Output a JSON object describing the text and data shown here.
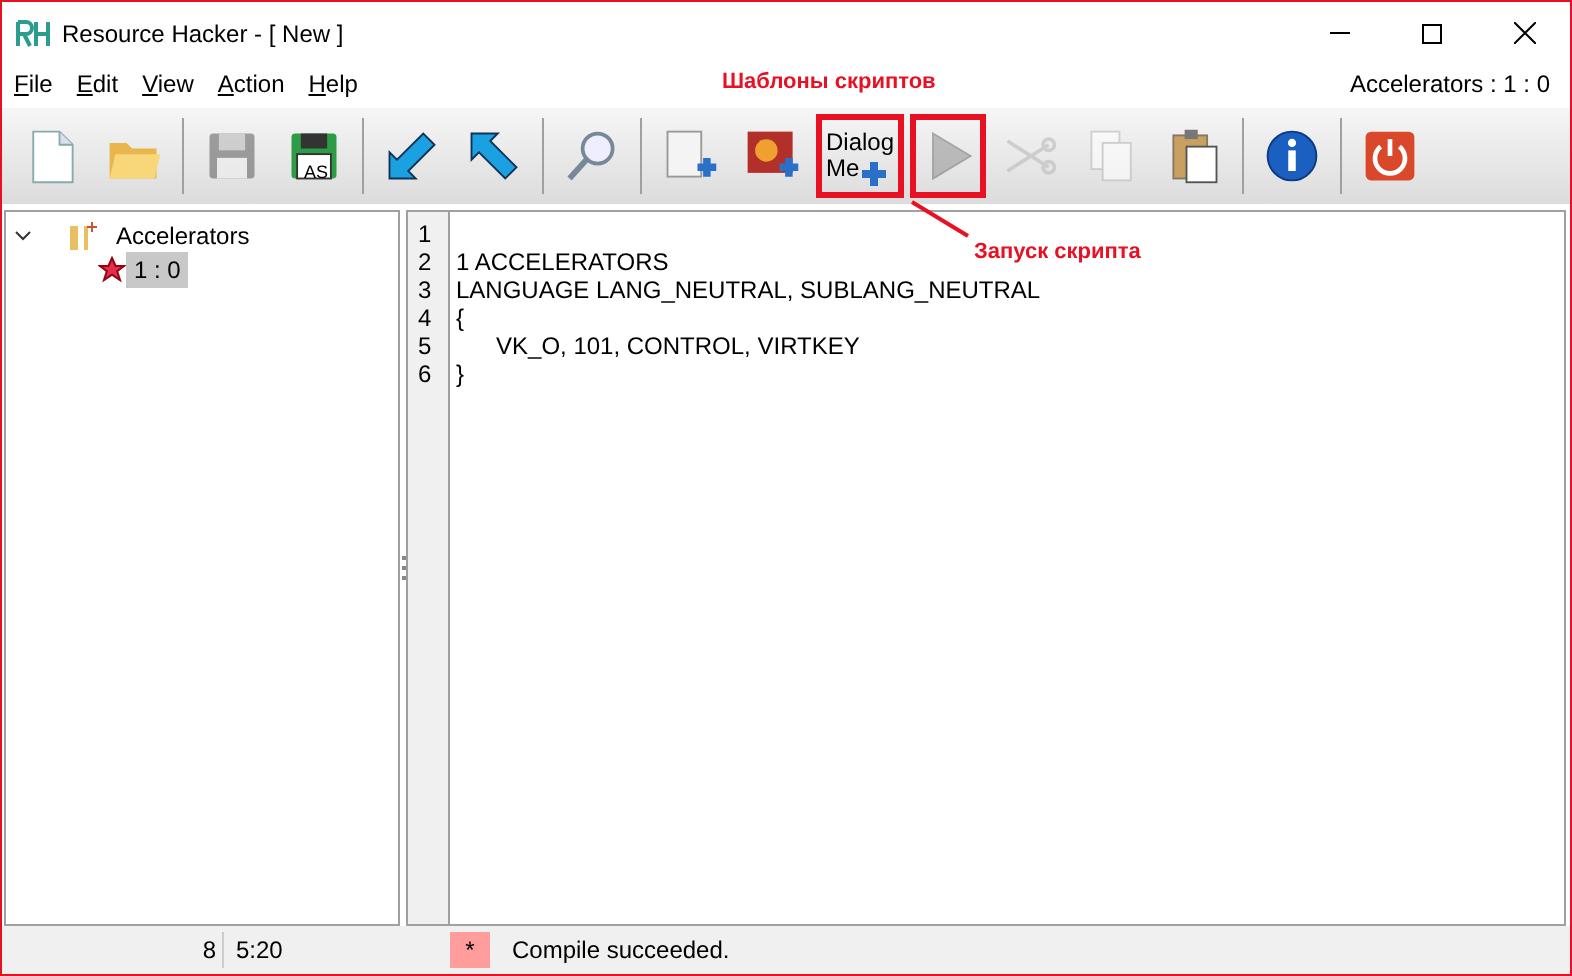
{
  "window": {
    "title": "Resource Hacker - [ New ]"
  },
  "menu": [
    {
      "label": "File"
    },
    {
      "label": "Edit"
    },
    {
      "label": "View"
    },
    {
      "label": "Action"
    },
    {
      "label": "Help"
    }
  ],
  "resource_label": "Accelerators : 1 : 0",
  "toolbar": [
    {
      "kind": "new",
      "disabled": false,
      "highlighted": false
    },
    {
      "kind": "open",
      "disabled": false,
      "highlighted": false
    },
    {
      "kind": "separator"
    },
    {
      "kind": "save",
      "disabled": true,
      "highlighted": false
    },
    {
      "kind": "save_as",
      "disabled": false,
      "highlighted": false,
      "label": "AS"
    },
    {
      "kind": "separator"
    },
    {
      "kind": "arrow_in",
      "disabled": false,
      "highlighted": false
    },
    {
      "kind": "arrow_out",
      "disabled": false,
      "highlighted": false
    },
    {
      "kind": "separator"
    },
    {
      "kind": "find",
      "disabled": false,
      "highlighted": false
    },
    {
      "kind": "separator"
    },
    {
      "kind": "add_blank",
      "disabled": false,
      "highlighted": false
    },
    {
      "kind": "add_image",
      "disabled": false,
      "highlighted": false
    },
    {
      "kind": "dialog",
      "disabled": false,
      "highlighted": true,
      "label_lines": [
        "Dialog",
        "Me"
      ]
    },
    {
      "kind": "run",
      "disabled": true,
      "highlighted": true
    },
    {
      "kind": "cut",
      "disabled": true,
      "highlighted": false
    },
    {
      "kind": "copy",
      "disabled": true,
      "highlighted": false
    },
    {
      "kind": "paste",
      "disabled": false,
      "highlighted": false
    },
    {
      "kind": "separator"
    },
    {
      "kind": "info",
      "disabled": false,
      "highlighted": false
    },
    {
      "kind": "separator"
    },
    {
      "kind": "exit",
      "disabled": false,
      "highlighted": false
    }
  ],
  "annotations": [
    {
      "kind": "top",
      "text": "Шаблоны скриптов"
    },
    {
      "kind": "arrow",
      "text": "Запуск скрипта"
    }
  ],
  "tree": [
    {
      "label": "Accelerators",
      "expanded": true,
      "selected": false,
      "children": [
        {
          "label": "1 : 0",
          "selected": true
        }
      ]
    }
  ],
  "editor": {
    "lines": [
      {
        "number": "1"
      },
      {
        "number": "2",
        "text": "1 ACCELERATORS"
      },
      {
        "number": "3",
        "text": "LANGUAGE LANG_NEUTRAL, SUBLANG_NEUTRAL"
      },
      {
        "number": "4",
        "text": "{"
      },
      {
        "number": "5",
        "text": "\tVK_O, 101, CONTROL, VIRTKEY"
      },
      {
        "number": "6",
        "text": "}"
      }
    ]
  },
  "status_bar": {
    "count": "8",
    "position": "5:20",
    "modified": "*",
    "message": "Compile succeeded."
  }
}
